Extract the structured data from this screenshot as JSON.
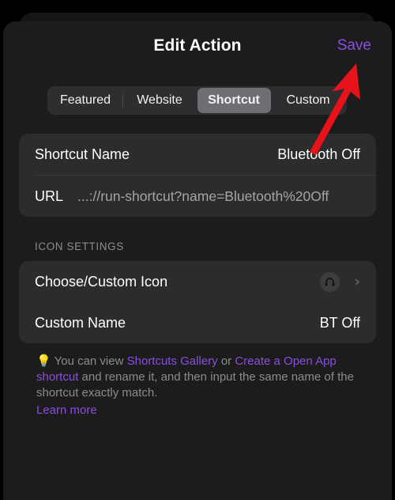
{
  "header": {
    "title": "Edit Action",
    "save_label": "Save"
  },
  "segmented": {
    "selected": "Shortcut",
    "options": [
      {
        "label": "Featured",
        "selected": false
      },
      {
        "label": "Website",
        "selected": false
      },
      {
        "label": "Shortcut",
        "selected": true
      },
      {
        "label": "Custom",
        "selected": false
      }
    ]
  },
  "shortcut_card": {
    "name_label": "Shortcut Name",
    "name_value": "Bluetooth Off",
    "url_label": "URL",
    "url_value": "...://run-shortcut?name=Bluetooth%20Off"
  },
  "icon_settings": {
    "section_title": "ICON SETTINGS",
    "choose_icon_label": "Choose/Custom Icon",
    "choose_icon_glyph": "headphones-icon",
    "chevron_glyph": "›",
    "custom_name_label": "Custom Name",
    "custom_name_value": "BT Off"
  },
  "footer": {
    "bulb_glyph": "💡",
    "text_1": "You can view ",
    "link_1": "Shortcuts Gallery",
    "text_2": " or ",
    "link_2": "Create a Open App shortcut",
    "text_3": " and rename it, and then input the same name of the shortcut exactly match.",
    "learn_more": "Learn more"
  },
  "annotation": {
    "arrow_color": "#e8121b",
    "arrow_target": "save-button"
  },
  "colors": {
    "accent_purple": "#8a4de2",
    "sheet_bg": "#1c1c1c",
    "card_bg": "#2c2c2c",
    "segmented_bg": "#2e2e30",
    "segmented_selected": "#6e6e73",
    "muted_text": "#8c8c8c"
  }
}
